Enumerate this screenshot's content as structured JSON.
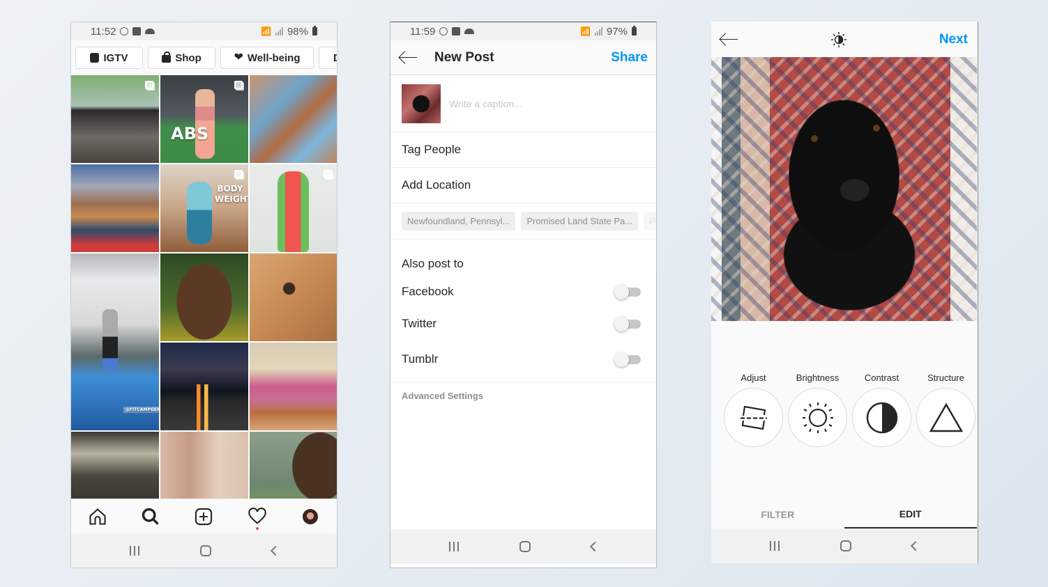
{
  "explore_screen": {
    "status": {
      "time": "11:52",
      "battery": "98%"
    },
    "chips": [
      {
        "label": "IGTV",
        "icon": "igtv-icon"
      },
      {
        "label": "Shop",
        "icon": "shopping-bag-icon"
      },
      {
        "label": "Well-being",
        "icon": "heart-icon"
      },
      {
        "label": "D",
        "icon": ""
      }
    ],
    "tile_overlays": {
      "abs": "ABS",
      "body_weight": "BODY WEIGHT",
      "watermark": "@FITCAMPGENOVA"
    },
    "bottom_nav": [
      "home-icon",
      "search-icon",
      "new-post-icon",
      "activity-heart-icon",
      "profile-avatar"
    ],
    "notification_dot_color": "#ed4956"
  },
  "new_post_screen": {
    "status": {
      "time": "11:59",
      "battery": "97%"
    },
    "title": "New Post",
    "share_label": "Share",
    "caption_placeholder": "Write a caption...",
    "tag_people": "Tag People",
    "add_location": "Add Location",
    "location_suggestions": [
      "Newfoundland, Pennsyl...",
      "Promised Land State Pa...",
      "Po"
    ],
    "also_post_to": "Also post to",
    "share_targets": [
      {
        "label": "Facebook",
        "enabled": false
      },
      {
        "label": "Twitter",
        "enabled": false
      },
      {
        "label": "Tumblr",
        "enabled": false
      }
    ],
    "advanced_settings": "Advanced Settings"
  },
  "edit_screen": {
    "next_label": "Next",
    "tools": [
      {
        "label": "Adjust",
        "icon": "adjust-icon"
      },
      {
        "label": "Brightness",
        "icon": "brightness-icon"
      },
      {
        "label": "Contrast",
        "icon": "contrast-icon"
      },
      {
        "label": "Structure",
        "icon": "structure-icon"
      }
    ],
    "tabs": [
      {
        "label": "FILTER",
        "active": false
      },
      {
        "label": "EDIT",
        "active": true
      }
    ]
  },
  "colors": {
    "accent_blue": "#0095f6",
    "text": "#262626",
    "muted": "#8e8e8e"
  }
}
